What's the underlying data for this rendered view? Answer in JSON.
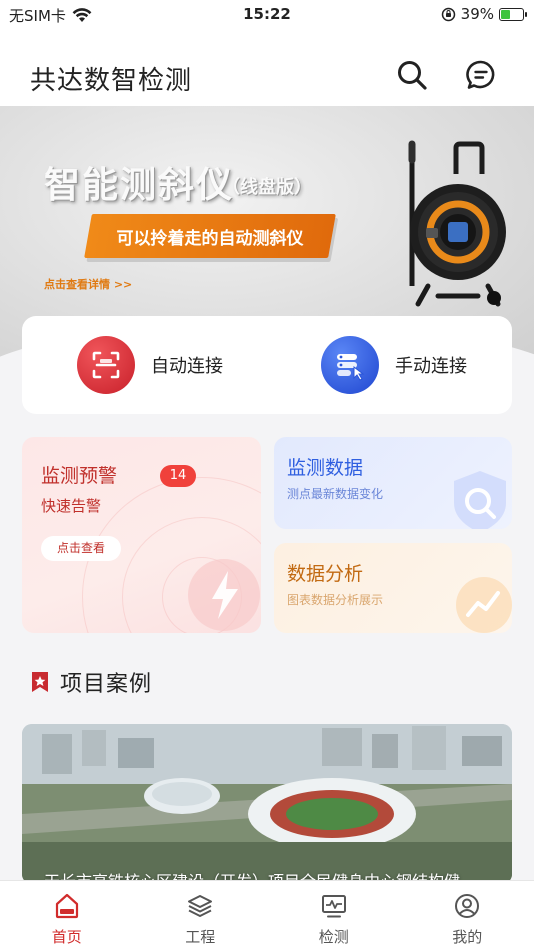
{
  "status_bar": {
    "carrier": "无SIM卡",
    "time": "15:22",
    "battery_percent": "39%",
    "battery_level": 0.39
  },
  "header": {
    "title": "共达数智检测",
    "icons": [
      "search-icon",
      "message-icon"
    ]
  },
  "banner": {
    "title": "智能测斜仪",
    "subtitle": "（线盘版）",
    "tag": "可以拎着走的自动测斜仪",
    "link": "点击查看详情 >>"
  },
  "connect": {
    "auto_label": "自动连接",
    "manual_label": "手动连接"
  },
  "tiles": {
    "warning": {
      "title": "监测预警",
      "badge": "14",
      "subtitle": "快速告警",
      "button": "点击查看"
    },
    "data": {
      "title": "监测数据",
      "subtitle": "测点最新数据变化"
    },
    "analysis": {
      "title": "数据分析",
      "subtitle": "图表数据分析展示"
    }
  },
  "section": {
    "title": "项目案例"
  },
  "project": {
    "caption": "天长市高铁核心区建设（开发）项目全民健身中心钢结构健"
  },
  "tabbar": {
    "items": [
      {
        "label": "首页",
        "icon": "home-icon",
        "active": true
      },
      {
        "label": "工程",
        "icon": "layers-icon",
        "active": false
      },
      {
        "label": "检测",
        "icon": "monitor-icon",
        "active": false
      },
      {
        "label": "我的",
        "icon": "profile-icon",
        "active": false
      }
    ]
  },
  "colors": {
    "accent_red": "#d12c2c",
    "badge_red": "#f0413b",
    "banner_orange": "#e8780f",
    "blue": "#2f5fe0"
  }
}
